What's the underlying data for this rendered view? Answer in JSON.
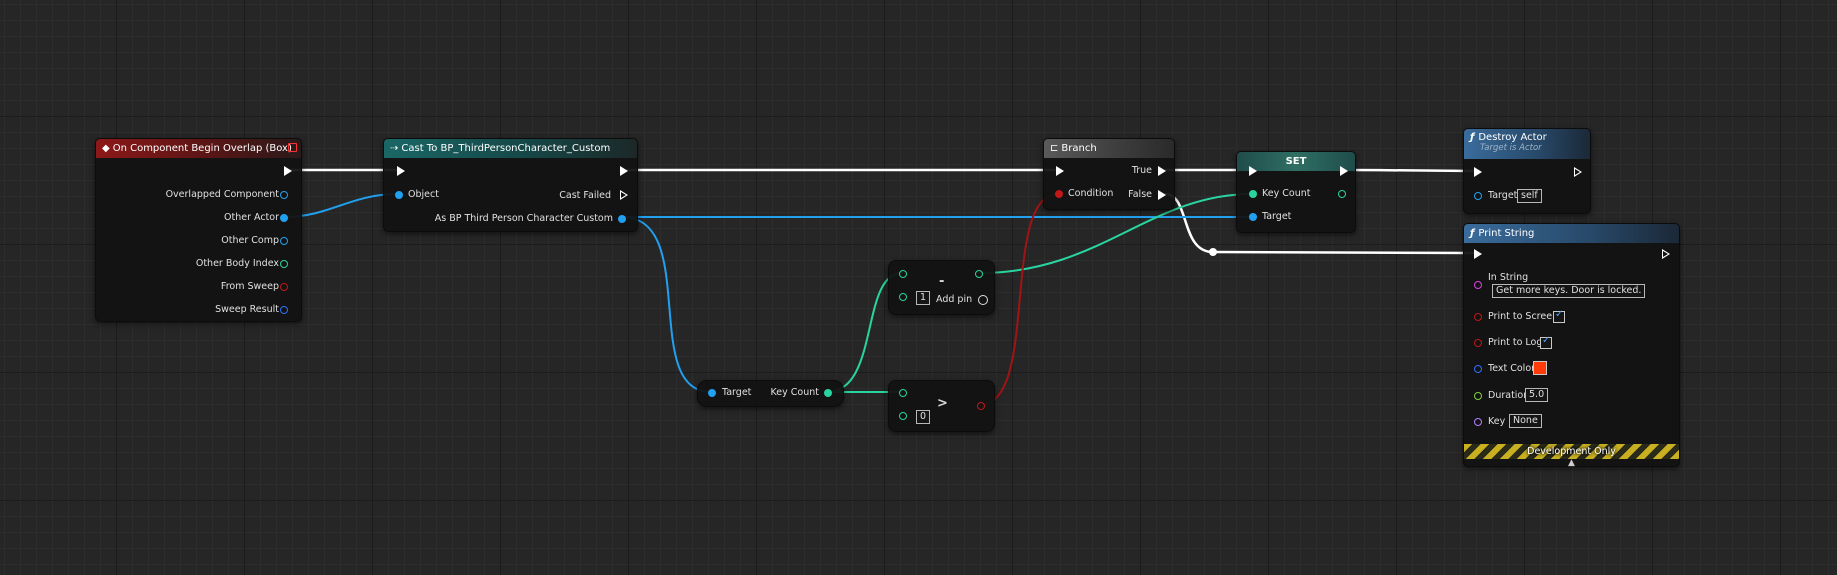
{
  "nodes": {
    "overlap": {
      "title": "On Component Begin Overlap (Box)",
      "pins": [
        "Overlapped Component",
        "Other Actor",
        "Other Comp",
        "Other Body Index",
        "From Sweep",
        "Sweep Result"
      ]
    },
    "cast": {
      "title": "Cast To BP_ThirdPersonCharacter_Custom",
      "object_label": "Object",
      "cast_failed_label": "Cast Failed",
      "as_label": "As BP Third Person Character Custom"
    },
    "keycount_getter": {
      "target_label": "Target",
      "keycount_label": "Key Count"
    },
    "subtract": {
      "symbol": "-",
      "value": "1",
      "add_pin_label": "Add pin"
    },
    "greater": {
      "symbol": ">",
      "value": "0"
    },
    "branch": {
      "title": "Branch",
      "condition_label": "Condition",
      "true_label": "True",
      "false_label": "False"
    },
    "set": {
      "title": "SET",
      "keycount_label": "Key Count",
      "target_label": "Target"
    },
    "destroy": {
      "title": "Destroy Actor",
      "subtitle": "Target is Actor",
      "target_label": "Target",
      "target_value": "self"
    },
    "print": {
      "title": "Print String",
      "in_string_label": "In String",
      "in_string_value": "Get more keys. Door is locked.",
      "print_screen_label": "Print to Screen",
      "print_log_label": "Print to Log",
      "text_color_label": "Text Color",
      "text_color_value": "#ff3b0a",
      "duration_label": "Duration",
      "duration_value": "5.0",
      "key_label": "Key",
      "key_value": "None",
      "dev_only_label": "Development Only"
    }
  },
  "colors": {
    "exec": "#ffffff",
    "object": "#22a0f0",
    "integer": "#2ad4a0",
    "boolean": "#c01818",
    "string": "#e040e0",
    "float": "#80d040",
    "name": "#b080ff",
    "struct": "#3070ff"
  },
  "icons": {
    "event": "diamond-event-icon",
    "cast": "cast-arrows-icon",
    "branch": "branch-icon",
    "function": "function-f-icon"
  }
}
